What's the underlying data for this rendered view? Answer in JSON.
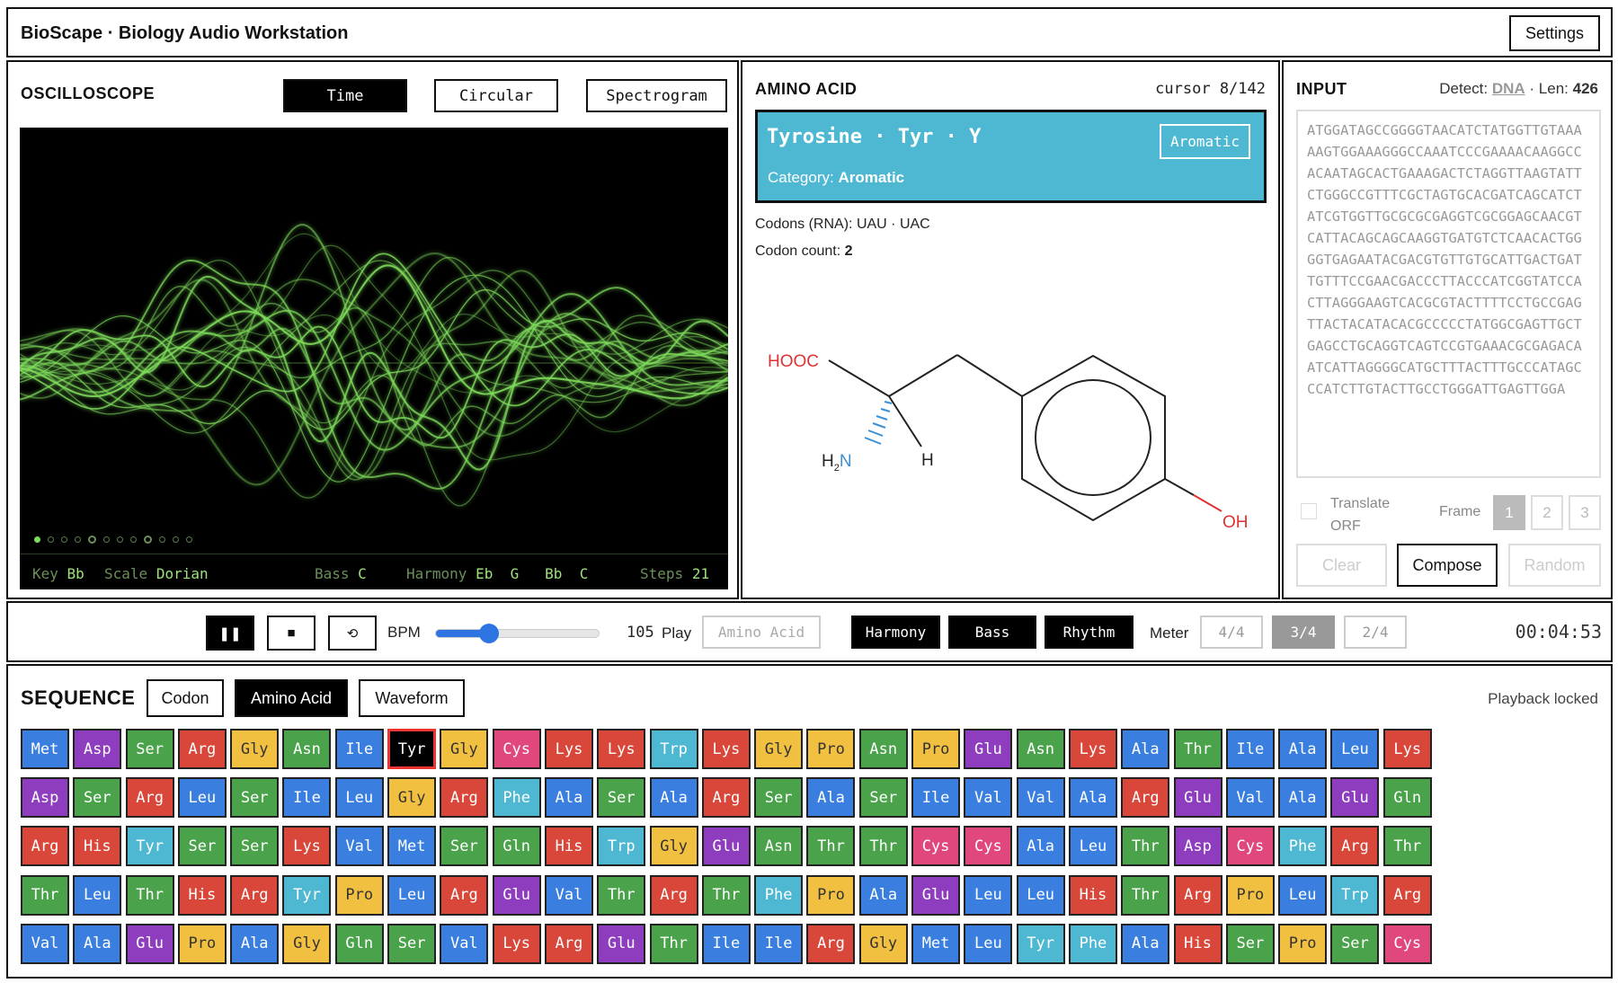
{
  "header": {
    "title": "BioScape · Biology Audio Workstation",
    "settings_label": "Settings"
  },
  "oscilloscope": {
    "title": "OSCILLOSCOPE",
    "modes": [
      "Time",
      "Circular",
      "Spectrogram"
    ],
    "active_mode": "Time",
    "status": {
      "key_label": "Key",
      "key": "Bb",
      "scale_label": "Scale",
      "scale": "Dorian",
      "bass_label": "Bass",
      "bass": "C",
      "harmony_label": "Harmony",
      "harmony": [
        "Eb",
        "G",
        "Bb",
        "C"
      ],
      "steps_label": "Steps",
      "steps": "21"
    },
    "trace_color": "#7edc5b"
  },
  "amino": {
    "title": "AMINO ACID",
    "cursor": "cursor 8/142",
    "name": "Tyrosine · Tyr · Y",
    "badge": "Aromatic",
    "category_label": "Category:",
    "category": "Aromatic",
    "codons_label": "Codons (RNA):",
    "codons": "UAU · UAC",
    "codon_count_label": "Codon count:",
    "codon_count": "2",
    "structure": {
      "hooc": "HOOC",
      "h2n": "H",
      "h2n_sub": "2",
      "n": "N",
      "h": "H",
      "oh": "OH"
    },
    "banner_color": "#4eb8d3"
  },
  "input": {
    "title": "INPUT",
    "detect_label": "Detect:",
    "detect_value": "DNA",
    "len_label": "· Len:",
    "len_value": "426",
    "sequence": "ATGGATAGCCGGGGTAACATCTATGGTTGTAAAAAGTGGAAAGGGCCAAATCCCGAAAACAAGGCCACAATAGCACTGAAAGACTCTAGGTTAAGTATTCTGGGCCGTTTCGCTAGTGCACGATCAGCATCTATCGTGGTTGCGCGCGAGGTCGCGGAGCAACGTCATTACAGCAGCAAGGTGATGTCTCAACACTGGGGTGAGAATACGACGTGTTGTGCATTGACTGATTGTTTCCGAACGACCCTTACCCATCGGTATCCACTTAGGGAAGTCACGCGTACTTTTCCTGCCGAGTTACTACATACACGCCCCCTATGGCGAGTTGCTGAGCCTGCAGGTCAGTCCGTGAAACGCGAGACAATCATTAGGGGCATGCTTTACTTTGCCCATAGCCCATCTTGTACTTGCCTGGGATTGAGTTGGA",
    "translate_label": "Translate ORF",
    "frame_label": "Frame",
    "frames": [
      "1",
      "2",
      "3"
    ],
    "active_frame": "1",
    "clear_label": "Clear",
    "compose_label": "Compose",
    "random_label": "Random"
  },
  "transport": {
    "pause_icon": "❚❚",
    "stop_icon": "■",
    "loop_icon": "⟲",
    "bpm_label": "BPM",
    "bpm": "105",
    "bpm_fraction": 0.33,
    "play_label": "Play",
    "play_mode": "Amino Acid",
    "toggles": [
      "Harmony",
      "Bass",
      "Rhythm"
    ],
    "meter_label": "Meter",
    "meters": [
      "4/4",
      "3/4",
      "2/4"
    ],
    "active_meter": "3/4",
    "time": "00:04:53"
  },
  "sequence": {
    "title": "SEQUENCE",
    "views": [
      "Codon",
      "Amino Acid",
      "Waveform"
    ],
    "active_view": "Amino Acid",
    "playback_locked": "Playback locked",
    "selected_index": 7,
    "residues": [
      "Met",
      "Asp",
      "Ser",
      "Arg",
      "Gly",
      "Asn",
      "Ile",
      "Tyr",
      "Gly",
      "Cys",
      "Lys",
      "Lys",
      "Trp",
      "Lys",
      "Gly",
      "Pro",
      "Asn",
      "Pro",
      "Glu",
      "Asn",
      "Lys",
      "Ala",
      "Thr",
      "Ile",
      "Ala",
      "Leu",
      "Lys",
      "Asp",
      "Ser",
      "Arg",
      "Leu",
      "Ser",
      "Ile",
      "Leu",
      "Gly",
      "Arg",
      "Phe",
      "Ala",
      "Ser",
      "Ala",
      "Arg",
      "Ser",
      "Ala",
      "Ser",
      "Ile",
      "Val",
      "Val",
      "Ala",
      "Arg",
      "Glu",
      "Val",
      "Ala",
      "Glu",
      "Gln",
      "Arg",
      "His",
      "Tyr",
      "Ser",
      "Ser",
      "Lys",
      "Val",
      "Met",
      "Ser",
      "Gln",
      "His",
      "Trp",
      "Gly",
      "Glu",
      "Asn",
      "Thr",
      "Thr",
      "Cys",
      "Cys",
      "Ala",
      "Leu",
      "Thr",
      "Asp",
      "Cys",
      "Phe",
      "Arg",
      "Thr",
      "Thr",
      "Leu",
      "Thr",
      "His",
      "Arg",
      "Tyr",
      "Pro",
      "Leu",
      "Arg",
      "Glu",
      "Val",
      "Thr",
      "Arg",
      "Thr",
      "Phe",
      "Pro",
      "Ala",
      "Glu",
      "Leu",
      "Leu",
      "His",
      "Thr",
      "Arg",
      "Pro",
      "Leu",
      "Trp",
      "Arg",
      "Val",
      "Ala",
      "Glu",
      "Pro",
      "Ala",
      "Gly",
      "Gln",
      "Ser",
      "Val",
      "Lys",
      "Arg",
      "Glu",
      "Thr",
      "Ile",
      "Ile",
      "Arg",
      "Gly",
      "Met",
      "Leu",
      "Tyr",
      "Phe",
      "Ala",
      "His",
      "Ser",
      "Pro",
      "Ser",
      "Cys"
    ]
  }
}
